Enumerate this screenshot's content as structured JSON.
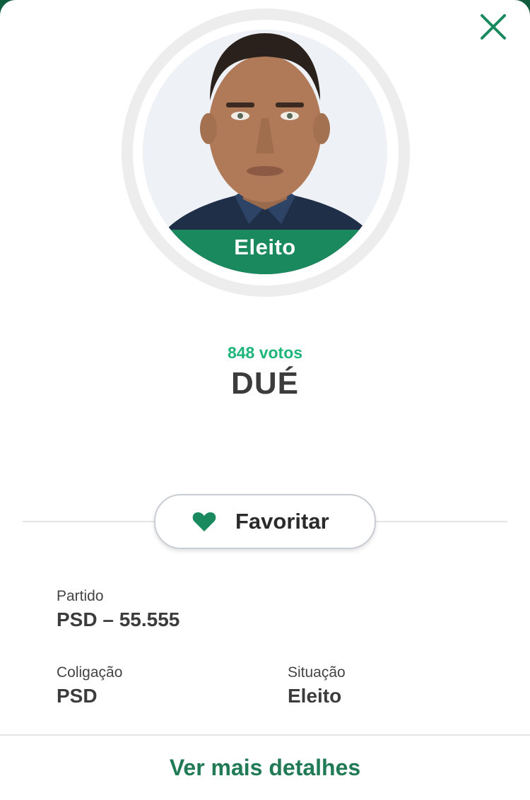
{
  "candidate": {
    "status": "Eleito",
    "votes": "848 votos",
    "name": "DUÉ"
  },
  "actions": {
    "favorite_label": "Favoritar",
    "details_link": "Ver mais detalhes"
  },
  "info": {
    "party_label": "Partido",
    "party_value": "PSD – 55.555",
    "coalition_label": "Coligação",
    "coalition_value": "PSD",
    "situation_label": "Situação",
    "situation_value": "Eleito"
  },
  "icons": {
    "close": "close-icon",
    "favorite": "heart-icon"
  },
  "colors": {
    "accent": "#1a8a5e",
    "votes": "#1eb57a",
    "link": "#1f7a55"
  }
}
